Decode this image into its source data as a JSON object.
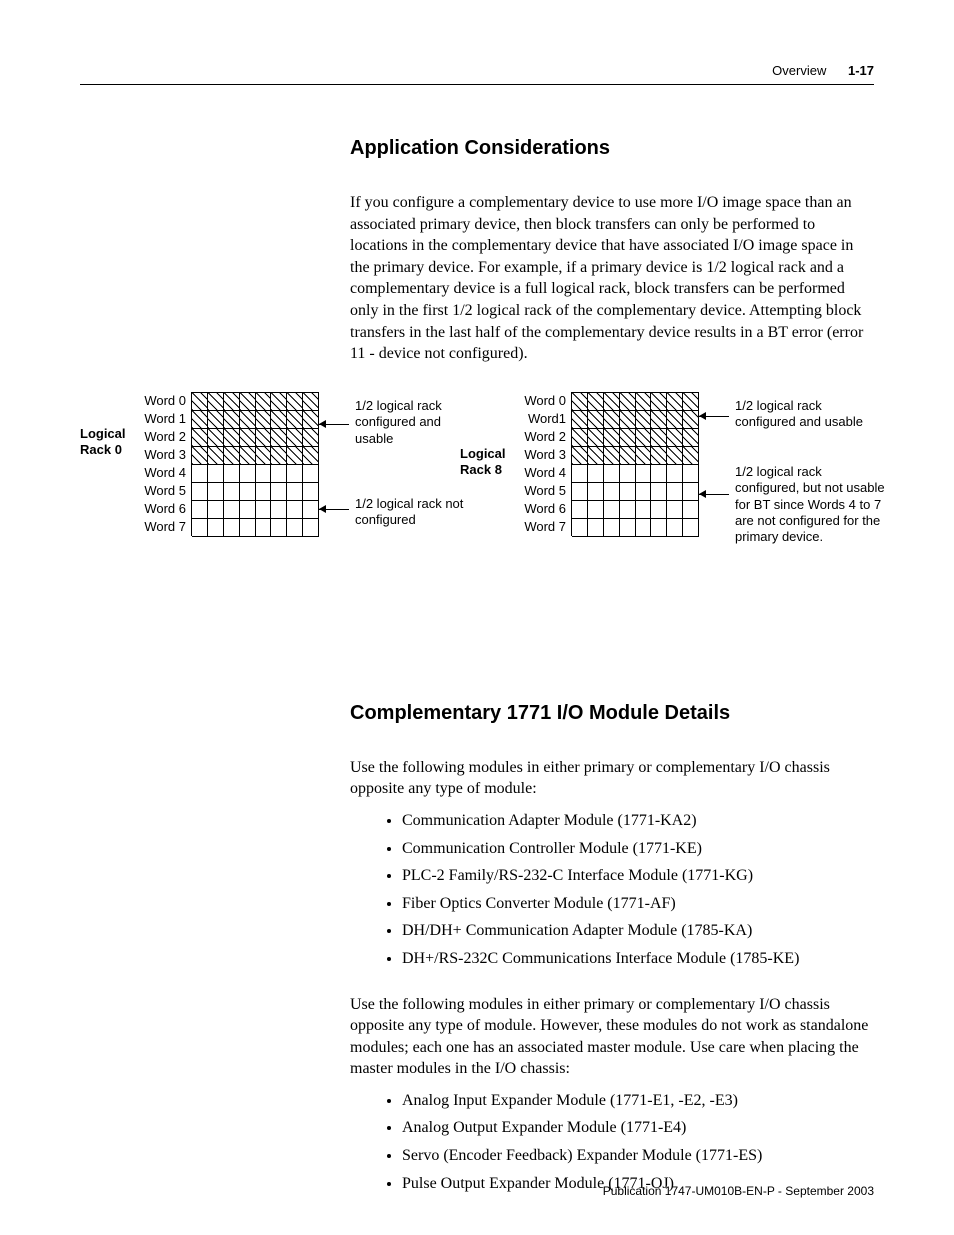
{
  "header": {
    "section": "Overview",
    "page": "1-17"
  },
  "h_app": "Application Considerations",
  "p_app": "If you configure a complementary device to use more I/O image space than an associated primary device, then block transfers can only be performed to locations in the complementary device that have associated I/O image space in the primary device. For example, if a primary device is 1/2 logical rack and a complementary device is a full logical rack, block transfers can be performed only in the first 1/2 logical rack of the complementary device. Attempting block transfers in the last half of the complementary device results in a BT error (error 11 - device not configured).",
  "diagram": {
    "rack0_label": "Logical Rack 0",
    "rack8_label": "Logical Rack 8",
    "words0": [
      "Word 0",
      "Word 1",
      "Word 2",
      "Word 3",
      "Word 4",
      "Word 5",
      "Word 6",
      "Word 7"
    ],
    "words8": [
      "Word 0",
      "Word1",
      "Word 2",
      "Word 3",
      "Word 4",
      "Word 5",
      "Word 6",
      "Word 7"
    ],
    "ann_a": "1/2 logical rack configured and usable",
    "ann_b": "1/2 logical rack not configured",
    "ann_c": "1/2 logical rack configured and usable",
    "ann_d": "1/2 logical rack configured, but not usable for BT since Words 4 to 7 are not configured for the primary device."
  },
  "h_comp": "Complementary 1771 I/O Module Details",
  "p_comp1": "Use the following modules in either primary or complementary I/O chassis opposite any type of module:",
  "list1": [
    "Communication Adapter Module (1771-KA2)",
    "Communication Controller Module (1771-KE)",
    "PLC-2 Family/RS-232-C Interface Module (1771-KG)",
    "Fiber Optics Converter Module (1771-AF)",
    "DH/DH+ Communication Adapter Module (1785-KA)",
    "DH+/RS-232C Communications Interface Module (1785-KE)"
  ],
  "p_comp2": "Use the following modules in either primary or complementary I/O chassis opposite any type of module. However, these modules do not work as standalone modules; each one has an associated master module. Use care when placing the master modules in the I/O chassis:",
  "list2": [
    "Analog Input Expander Module (1771-E1, -E2, -E3)",
    "Analog Output Expander Module (1771-E4)",
    "Servo (Encoder Feedback) Expander Module (1771-ES)",
    "Pulse Output Expander Module (1771-OJ)"
  ],
  "footer": "Publication 1747-UM010B-EN-P - September 2003"
}
